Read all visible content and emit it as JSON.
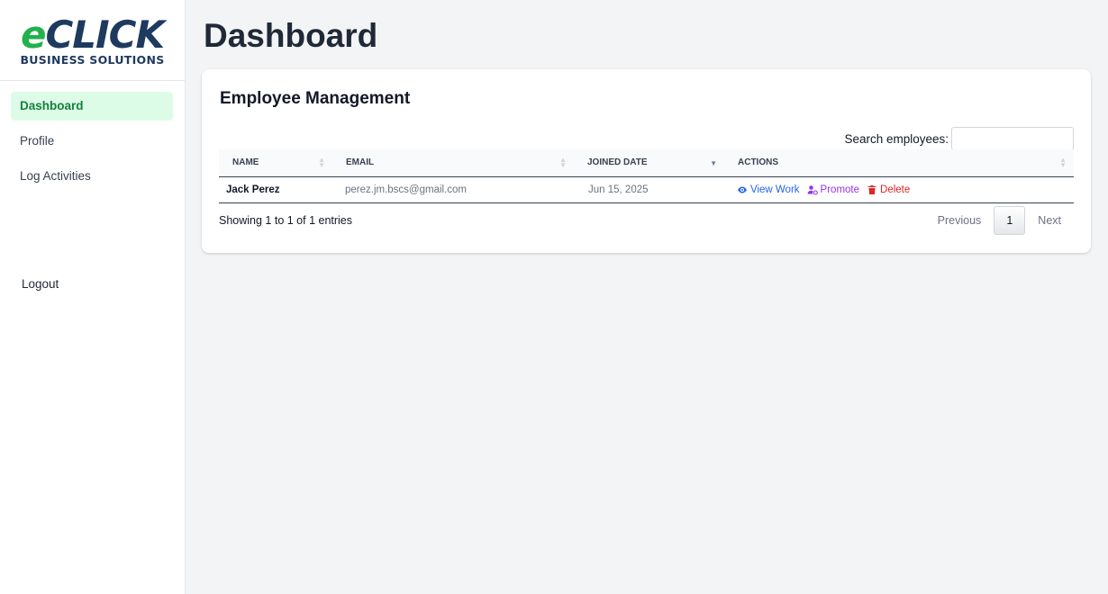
{
  "brand": {
    "logo_e": "e",
    "logo_click": "CLICK",
    "logo_sub": "BUSINESS SOLUTIONS",
    "accent_green": "#22b14c",
    "navy": "#1e3a5f"
  },
  "sidebar": {
    "items": [
      {
        "label": "Dashboard",
        "active": true
      },
      {
        "label": "Profile",
        "active": false
      },
      {
        "label": "Log Activities",
        "active": false
      }
    ],
    "logout": "Logout"
  },
  "page": {
    "title": "Dashboard"
  },
  "card": {
    "title": "Employee Management",
    "search_label": "Search employees:",
    "search_value": "",
    "columns": [
      "NAME",
      "EMAIL",
      "JOINED DATE",
      "ACTIONS"
    ],
    "rows": [
      {
        "name": "Jack Perez",
        "email": "perez.jm.bscs@gmail.com",
        "joined": "Jun 15, 2025",
        "actions": {
          "view": "View Work",
          "promote": "Promote",
          "delete": "Delete"
        }
      }
    ],
    "info": "Showing 1 to 1 of 1 entries",
    "pagination": {
      "previous": "Previous",
      "current": "1",
      "next": "Next"
    }
  },
  "icons": {
    "view": "eye-icon",
    "promote": "user-cog-icon",
    "delete": "trash-icon"
  }
}
